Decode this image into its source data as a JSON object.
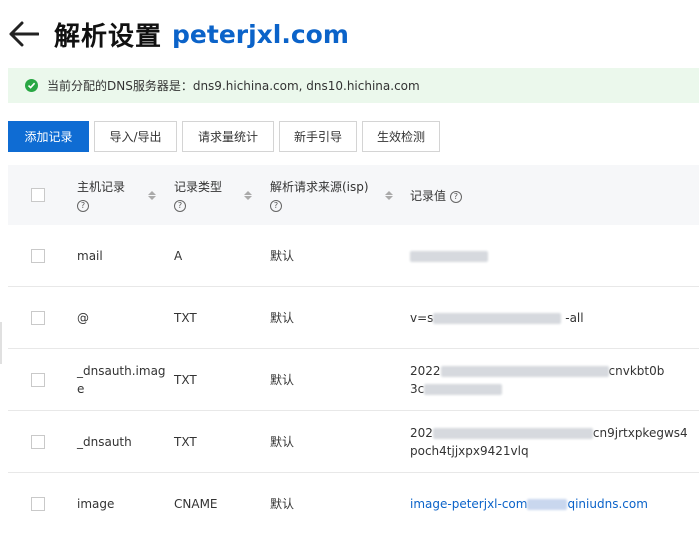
{
  "header": {
    "title": "解析设置",
    "domain": "peterjxl.com"
  },
  "notice": {
    "text": "当前分配的DNS服务器是：dns9.hichina.com, dns10.hichina.com"
  },
  "toolbar": {
    "add": "添加记录",
    "import_export": "导入/导出",
    "request_stats": "请求量统计",
    "guide": "新手引导",
    "check": "生效检测"
  },
  "table": {
    "headers": {
      "host": "主机记录",
      "type": "记录类型",
      "source": "解析请求来源(isp)",
      "value": "记录值"
    },
    "rows": [
      {
        "host": "mail",
        "type": "A",
        "source": "默认",
        "value_line1": "",
        "value_line2": ""
      },
      {
        "host": "@",
        "type": "TXT",
        "source": "默认",
        "value_line1": "v=s",
        "value_tail": "-all"
      },
      {
        "host_line1": "_dnsauth.imag",
        "host_line2": "e",
        "type": "TXT",
        "source": "默认",
        "value_line1_head": "2022",
        "value_line1_tail": "cnvkbt0b",
        "value_line2_head": "3c"
      },
      {
        "host": "_dnsauth",
        "type": "TXT",
        "source": "默认",
        "value_line1_head": "202",
        "value_line1_tail": "cn9jrtxpkegws4",
        "value_line2": "poch4tjjxpx9421vlq"
      },
      {
        "host": "image",
        "type": "CNAME",
        "source": "默认",
        "value_head": "image-peterjxl-com",
        "value_tail": "qiniudns.com"
      }
    ]
  },
  "colors": {
    "accent": "#0f6cd3",
    "link": "#0b63c9",
    "success": "#29a744"
  }
}
